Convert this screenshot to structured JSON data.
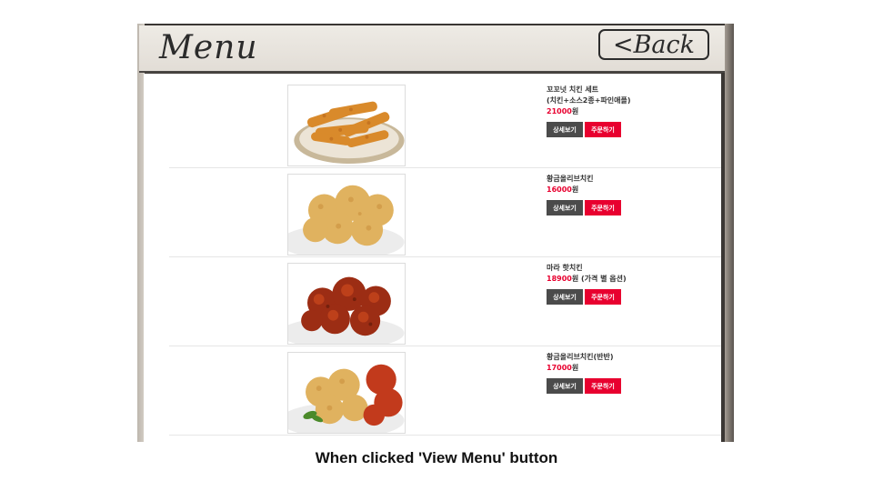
{
  "header": {
    "title": "Menu",
    "back_label": "<Back"
  },
  "items": [
    {
      "name_lines": [
        "꼬꼬넛 치킨 세트",
        "(치킨+소스2종+파인애플)"
      ],
      "price": "21000",
      "suffix": "원",
      "detail_label": "상세보기",
      "order_label": "주문하기"
    },
    {
      "name_lines": [
        "황금올리브치킨",
        ""
      ],
      "price": "16000",
      "suffix": "원",
      "detail_label": "상세보기",
      "order_label": "주문하기"
    },
    {
      "name_lines": [
        "마라 핫치킨",
        ""
      ],
      "price": "18900",
      "suffix": "원 (가격 별 옵션)",
      "detail_label": "상세보기",
      "order_label": "주문하기"
    },
    {
      "name_lines": [
        "황금올리브치킨(반반)",
        ""
      ],
      "price": "17000",
      "suffix": "원",
      "detail_label": "상세보기",
      "order_label": "주문하기"
    }
  ],
  "caption": "When clicked 'View Menu' button",
  "colors": {
    "accent": "#e8002f",
    "detail_button": "#4b4b4b",
    "frame": "#3a3633"
  }
}
